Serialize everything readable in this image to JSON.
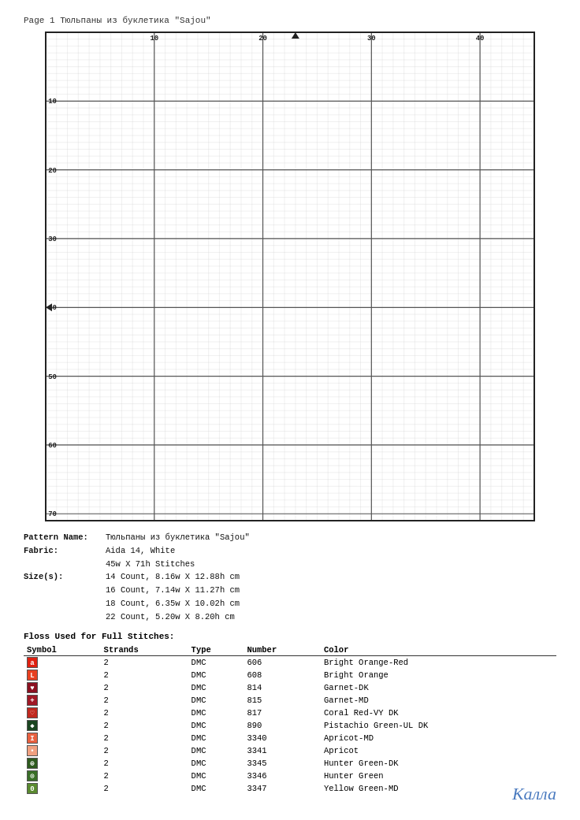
{
  "page": {
    "header": "Page 1   Тюльпаны из буклетика \"Sajou\"",
    "pattern_name": "Тюльпаны из буклетика \"Sajou\"",
    "fabric": "Aida 14, White",
    "stitches": "45w X 71h Stitches",
    "sizes": [
      {
        "count": "14 Count,",
        "size": "8.16w X 12.88h cm"
      },
      {
        "count": "16 Count,",
        "size": "7.14w X 11.27h cm"
      },
      {
        "count": "18 Count,",
        "size": "6.35w X 10.02h cm"
      },
      {
        "count": "22 Count,",
        "size": "5.20w X 8.20h cm"
      }
    ],
    "floss_title": "Floss Used for Full Stitches:",
    "floss_headers": [
      "Symbol",
      "Strands",
      "Type",
      "Number",
      "Color"
    ],
    "floss_rows": [
      {
        "symbol": "a",
        "strands": "2",
        "type": "DMC",
        "number": "606",
        "color": "Bright Orange-Red",
        "swatch": "#e02010"
      },
      {
        "symbol": "L",
        "strands": "2",
        "type": "DMC",
        "number": "608",
        "color": "Bright Orange",
        "swatch": "#e84020"
      },
      {
        "symbol": "♥",
        "strands": "2",
        "type": "DMC",
        "number": "814",
        "color": "Garnet-DK",
        "swatch": "#8b1020"
      },
      {
        "symbol": "+",
        "strands": "2",
        "type": "DMC",
        "number": "815",
        "color": "Garnet-MD",
        "swatch": "#a01825"
      },
      {
        "symbol": "♡",
        "strands": "2",
        "type": "DMC",
        "number": "817",
        "color": "Coral Red-VY DK",
        "swatch": "#c0281e"
      },
      {
        "symbol": "◆",
        "strands": "2",
        "type": "DMC",
        "number": "890",
        "color": "Pistachio Green-UL DK",
        "swatch": "#1a4520"
      },
      {
        "symbol": "I",
        "strands": "2",
        "type": "DMC",
        "number": "3340",
        "color": "Apricot-MD",
        "swatch": "#e86040"
      },
      {
        "symbol": "•",
        "strands": "2",
        "type": "DMC",
        "number": "3341",
        "color": "Apricot",
        "swatch": "#f0a080"
      },
      {
        "symbol": "⊕",
        "strands": "2",
        "type": "DMC",
        "number": "3345",
        "color": "Hunter Green-DK",
        "swatch": "#2d5a1e"
      },
      {
        "symbol": "⊙",
        "strands": "2",
        "type": "DMC",
        "number": "3346",
        "color": "Hunter Green",
        "swatch": "#3a6e28"
      },
      {
        "symbol": "0",
        "strands": "2",
        "type": "DMC",
        "number": "3347",
        "color": "Yellow Green-MD",
        "swatch": "#5a8a30"
      }
    ],
    "signature": "Калла"
  }
}
